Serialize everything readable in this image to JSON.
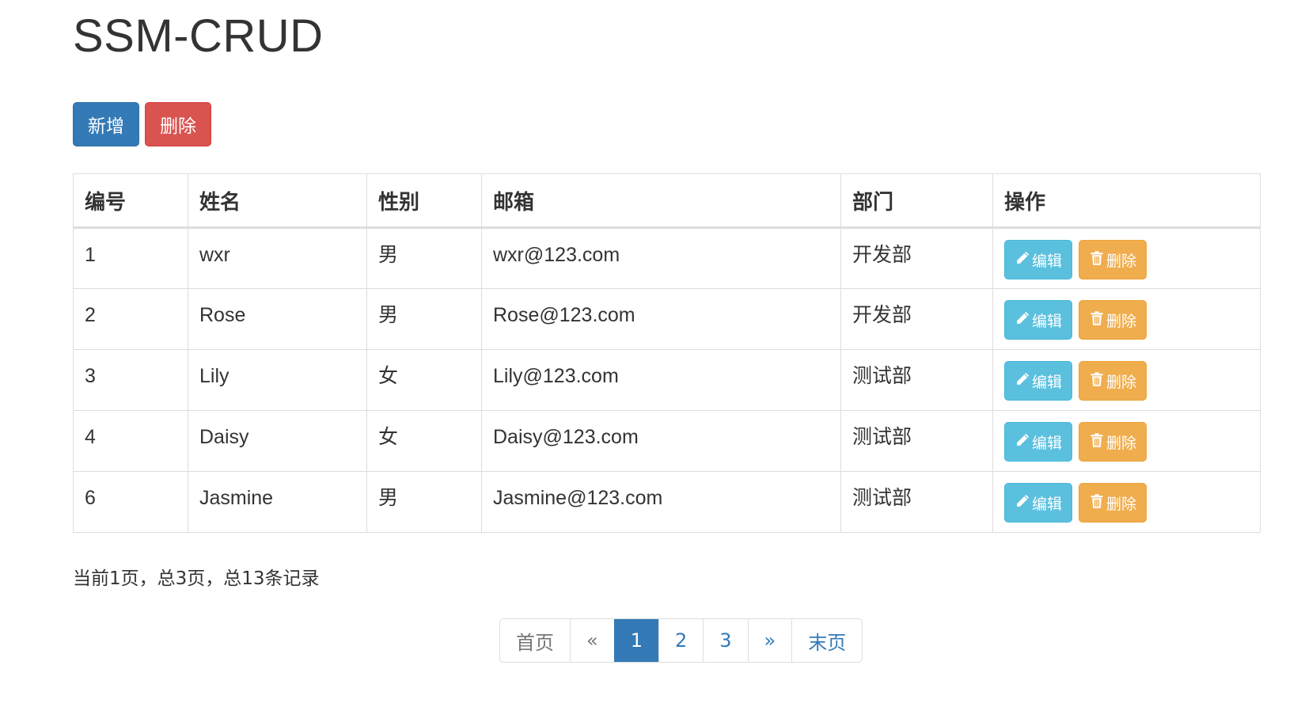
{
  "page_title": "SSM-CRUD",
  "toolbar": {
    "add_label": "新增",
    "delete_label": "删除"
  },
  "table": {
    "headers": [
      "编号",
      "姓名",
      "性别",
      "邮箱",
      "部门",
      "操作"
    ],
    "rows": [
      {
        "id": "1",
        "name": "wxr",
        "gender": "男",
        "email": "wxr@123.com",
        "dept": "开发部"
      },
      {
        "id": "2",
        "name": "Rose",
        "gender": "男",
        "email": "Rose@123.com",
        "dept": "开发部"
      },
      {
        "id": "3",
        "name": "Lily",
        "gender": "女",
        "email": "Lily@123.com",
        "dept": "测试部"
      },
      {
        "id": "4",
        "name": "Daisy",
        "gender": "女",
        "email": "Daisy@123.com",
        "dept": "测试部"
      },
      {
        "id": "6",
        "name": "Jasmine",
        "gender": "男",
        "email": "Jasmine@123.com",
        "dept": "测试部"
      }
    ],
    "edit_label": "编辑",
    "delete_label": "删除",
    "edit_icon": "pencil-icon",
    "delete_icon": "trash-icon"
  },
  "summary": "当前1页，总3页，总13条记录",
  "pagination": {
    "first": "首页",
    "prev": "«",
    "pages": [
      "1",
      "2",
      "3"
    ],
    "current": "1",
    "next": "»",
    "last": "末页"
  },
  "colors": {
    "primary": "#337ab7",
    "danger": "#d9534f",
    "info": "#5bc0de",
    "warning": "#f0ad4e"
  }
}
